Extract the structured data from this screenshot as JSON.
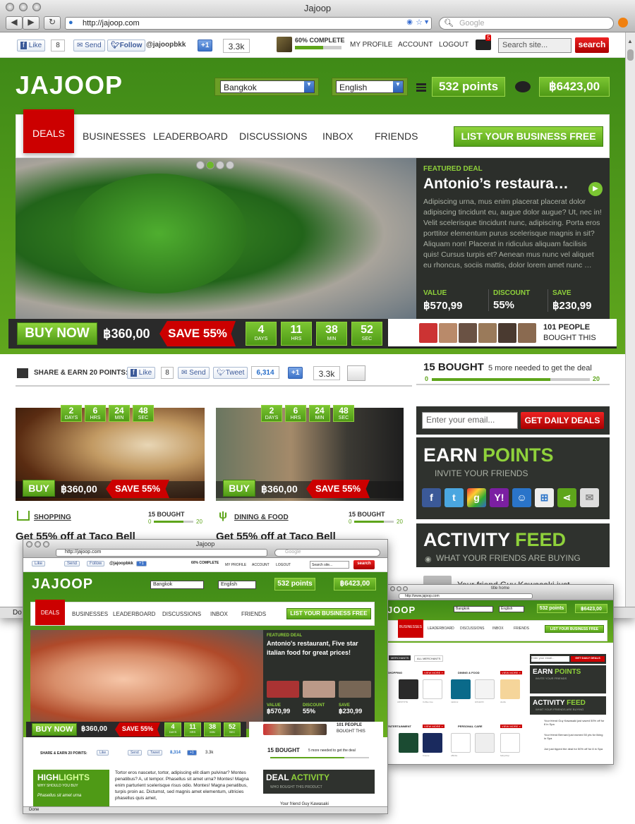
{
  "main": {
    "title": "Jajoop",
    "url": "http://jajoop.com",
    "google": "Google",
    "social": {
      "like": "Like",
      "like_count": "8",
      "send": "Send",
      "follow": "Follow",
      "handle": "@jajoopbkk",
      "plus": "+1",
      "plus_count": "3.3k"
    },
    "profile": {
      "complete": "60% COMPLETE",
      "progress": 0.6,
      "links": [
        "MY PROFILE",
        "ACCOUNT",
        "LOGOUT"
      ],
      "mail_count": "5",
      "search_placeholder": "Search site...",
      "search_btn": "search"
    },
    "header": {
      "logo": "JAJOOP",
      "city": "Bangkok",
      "language": "English",
      "points": "532 points",
      "balance": "฿6423,00"
    },
    "nav": {
      "items": [
        "DEALS",
        "BUSINESSES",
        "LEADERBOARD",
        "DISCUSSIONS",
        "INBOX",
        "FRIENDS"
      ],
      "cta": "LIST YOUR BUSINESS FREE"
    },
    "featured": {
      "label": "FEATURED DEAL",
      "title": "Antonio’s restaura…",
      "desc": "Adipiscing urna, mus enim placerat placerat dolor adipiscing tincidunt eu, augue dolor augue? Ut, nec in! Velit scelerisque tincidunt nunc, adipiscing. Porta eros porttitor elementum purus scelerisque magnis in sit? Aliquam non! Placerat in ridiculus aliquam facilisis quis! Cursus turpis et? Aenean mus nunc vel aliquet eu rhoncus, sociis mattis, dolor lorem amet nunc …",
      "value_label": "VALUE",
      "value": "฿570,99",
      "discount_label": "DISCOUNT",
      "discount": "55%",
      "save_label": "SAVE",
      "save": "฿230,99"
    },
    "buy": {
      "buy_now": "BUY NOW",
      "price": "฿360,00",
      "save": "SAVE 55%",
      "countdown": [
        {
          "v": "4",
          "u": "DAYS"
        },
        {
          "v": "11",
          "u": "HRS"
        },
        {
          "v": "38",
          "u": "MIN"
        },
        {
          "v": "52",
          "u": "SEC"
        }
      ],
      "people": "101 PEOPLE",
      "bought_this": "BOUGHT THIS"
    },
    "share": {
      "label": "SHARE & EARN 20 POINTS:",
      "like": "Like",
      "like_count": "8",
      "send": "Send",
      "tweet": "Tweet",
      "tweet_count": "6,314",
      "plus": "+1",
      "plus_count": "3.3k"
    },
    "bought": {
      "count": "15 BOUGHT",
      "more": "5 more needed to get the deal",
      "min": "0",
      "max": "20",
      "progress": 0.75
    },
    "deals": [
      {
        "countdown": [
          {
            "v": "2",
            "u": "DAYS"
          },
          {
            "v": "6",
            "u": "HRS"
          },
          {
            "v": "24",
            "u": "MIN"
          },
          {
            "v": "48",
            "u": "SEC"
          }
        ],
        "buy": "BUY",
        "price": "฿360,00",
        "save": "SAVE 55%",
        "category": "SHOPPING",
        "bought": "15 BOUGHT",
        "min": "0",
        "max": "20",
        "progress": 0.75,
        "title": "Get 55% off at Taco Bell"
      },
      {
        "countdown": [
          {
            "v": "2",
            "u": "DAYS"
          },
          {
            "v": "6",
            "u": "HRS"
          },
          {
            "v": "24",
            "u": "MIN"
          },
          {
            "v": "48",
            "u": "SEC"
          }
        ],
        "buy": "BUY",
        "price": "฿360,00",
        "save": "SAVE 55%",
        "category": "DINING & FOOD",
        "bought": "15 BOUGHT",
        "min": "0",
        "max": "20",
        "progress": 0.75,
        "title": "Get 55% off at Taco Bell"
      }
    ],
    "sidebar": {
      "email_placeholder": "Enter your email...",
      "daily_btn": "GET DAILY DEALS",
      "earn_a": "EARN",
      "earn_b": "POINTS",
      "earn_sub": "INVITE YOUR FRIENDS",
      "activity_a": "ACTIVITY",
      "activity_b": "FEED",
      "activity_sub": "WHAT YOUR FRIENDS ARE BUYING",
      "feed_item": "Your friend Guy Kawasaki just"
    },
    "status": "Do"
  },
  "second": {
    "title": "Jajoop",
    "url": "http://jajoop.com",
    "google": "Google",
    "social": {
      "like": "Like",
      "like_count": "8",
      "send": "Send",
      "follow": "Follow",
      "handle": "@jajoopbkk",
      "plus": "+1",
      "plus_count": "3.3k"
    },
    "profile": {
      "complete": "60% COMPLETE",
      "links": [
        "MY PROFILE",
        "ACCOUNT",
        "LOGOUT"
      ],
      "search_placeholder": "Search site...",
      "search_btn": "search"
    },
    "header": {
      "logo": "JAJOOP",
      "city": "Bangkok",
      "language": "English",
      "points": "532 points",
      "balance": "฿6423,00"
    },
    "nav": {
      "items": [
        "DEALS",
        "BUSINESSES",
        "LEADERBOARD",
        "DISCUSSIONS",
        "INBOX",
        "FRIENDS"
      ],
      "cta": "LIST YOUR BUSINESS FREE"
    },
    "featured": {
      "label": "FEATURED DEAL",
      "title": "Antonio's restaurant, Five star italian food for great prices!",
      "value_label": "VALUE",
      "value": "฿570,99",
      "discount_label": "DISCOUNT",
      "discount": "55%",
      "save_label": "SAVE",
      "save": "฿230,99"
    },
    "buy": {
      "buy_now": "BUY NOW",
      "price": "฿360,00",
      "save": "SAVE 55%",
      "countdown": [
        {
          "v": "4",
          "u": "DAYS"
        },
        {
          "v": "11",
          "u": "HRS"
        },
        {
          "v": "38",
          "u": "MIN"
        },
        {
          "v": "52",
          "u": "SEC"
        }
      ],
      "people": "101 PEOPLE",
      "bought_this": "BOUGHT THIS"
    },
    "share": {
      "label": "SHARE & EARN 20 POINTS:",
      "like": "Like",
      "like_count": "8",
      "send": "Send",
      "tweet": "Tweet",
      "tweet_count": "8,314",
      "plus": "+1",
      "plus_count": "3.3k"
    },
    "bought": {
      "count": "15 BOUGHT",
      "more": "5 more needed to get the deal",
      "min": "0",
      "max": "20"
    },
    "highlights": {
      "a": "HIGH",
      "b": "LIGHTS",
      "sub": "WHY SHOULD YOU BUY",
      "item": "Phasellus sit amet urna",
      "text": "Tortor eros nascetur, tortor, adipiscing elit diam pulvinar? Montes penatibus? A, ut tempor. Phasellus sit amet urna? Montes! Magna enim parturient scelerisque risus odio. Montes! Magna penatibus, turpis proin ac. Dictumst, sed magnis amet elementum, ultricies phasellus quis amet,"
    },
    "deal_activity": {
      "a": "DEAL",
      "b": "ACTIVITY",
      "sub": "WHO BOUGHT THIS PRODUCT",
      "item": "Your friend Guy Kawasaki"
    },
    "status": "Done"
  },
  "third": {
    "title": "title home",
    "url": "http://www.jajoop.com",
    "header": {
      "logo": "JOOP",
      "city": "Bangkok",
      "language": "English",
      "points": "532 points",
      "balance": "฿6423,00"
    },
    "nav": {
      "items": [
        "BUSINESSES",
        "LEADERBOARD",
        "DISCUSSIONS",
        "INBOX",
        "FRIENDS"
      ],
      "cta": "LIST YOUR BUSINESS FREE"
    },
    "tabs": [
      "MERCHANTS",
      "ALL MERCHANTS"
    ],
    "sections": [
      {
        "name": "SHOPPING",
        "more": "VIEW MORE »"
      },
      {
        "name": "DINING & FOOD",
        "more": "VIEW MORE »"
      },
      {
        "name": "ENTERTAINMENT",
        "more": "VIEW MORE »"
      },
      {
        "name": "PERSONAL CARE",
        "more": "VIEW MORE »"
      }
    ],
    "merchants": [
      "ARISTOTE",
      "Coffee tree",
      "naktinui",
      "HOLEON",
      "doolle",
      "Krause",
      "oBirdie",
      "",
      "babyshop"
    ],
    "sidebar": {
      "email_placeholder": "Enter your email...",
      "daily_btn": "GET DAILY DEALS",
      "earn_a": "EARN",
      "earn_b": "POINTS",
      "earn_sub": "INVITE YOUR FRIENDS",
      "activity_a": "ACTIVITY",
      "activity_b": "FEED",
      "activity_sub": "WHAT YOUR FRIENDS ARE BUYING",
      "feed": [
        "Your friend Guy Kawasaki just saved 50% off for 8 in Spa",
        "Your friend Bernard just earned 50 pts for liking in Spa",
        "Joe just tipped the deal for 50% off for 8 in Spa"
      ]
    }
  }
}
